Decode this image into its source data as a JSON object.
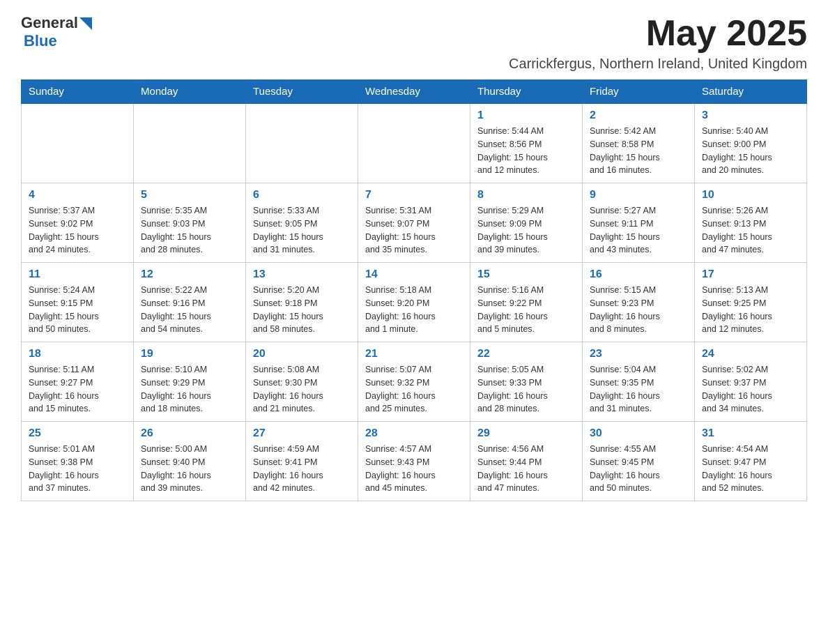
{
  "header": {
    "logo_general": "General",
    "logo_blue": "Blue",
    "month_title": "May 2025",
    "location": "Carrickfergus, Northern Ireland, United Kingdom"
  },
  "days_of_week": [
    "Sunday",
    "Monday",
    "Tuesday",
    "Wednesday",
    "Thursday",
    "Friday",
    "Saturday"
  ],
  "weeks": [
    [
      {
        "day": "",
        "info": ""
      },
      {
        "day": "",
        "info": ""
      },
      {
        "day": "",
        "info": ""
      },
      {
        "day": "",
        "info": ""
      },
      {
        "day": "1",
        "info": "Sunrise: 5:44 AM\nSunset: 8:56 PM\nDaylight: 15 hours\nand 12 minutes."
      },
      {
        "day": "2",
        "info": "Sunrise: 5:42 AM\nSunset: 8:58 PM\nDaylight: 15 hours\nand 16 minutes."
      },
      {
        "day": "3",
        "info": "Sunrise: 5:40 AM\nSunset: 9:00 PM\nDaylight: 15 hours\nand 20 minutes."
      }
    ],
    [
      {
        "day": "4",
        "info": "Sunrise: 5:37 AM\nSunset: 9:02 PM\nDaylight: 15 hours\nand 24 minutes."
      },
      {
        "day": "5",
        "info": "Sunrise: 5:35 AM\nSunset: 9:03 PM\nDaylight: 15 hours\nand 28 minutes."
      },
      {
        "day": "6",
        "info": "Sunrise: 5:33 AM\nSunset: 9:05 PM\nDaylight: 15 hours\nand 31 minutes."
      },
      {
        "day": "7",
        "info": "Sunrise: 5:31 AM\nSunset: 9:07 PM\nDaylight: 15 hours\nand 35 minutes."
      },
      {
        "day": "8",
        "info": "Sunrise: 5:29 AM\nSunset: 9:09 PM\nDaylight: 15 hours\nand 39 minutes."
      },
      {
        "day": "9",
        "info": "Sunrise: 5:27 AM\nSunset: 9:11 PM\nDaylight: 15 hours\nand 43 minutes."
      },
      {
        "day": "10",
        "info": "Sunrise: 5:26 AM\nSunset: 9:13 PM\nDaylight: 15 hours\nand 47 minutes."
      }
    ],
    [
      {
        "day": "11",
        "info": "Sunrise: 5:24 AM\nSunset: 9:15 PM\nDaylight: 15 hours\nand 50 minutes."
      },
      {
        "day": "12",
        "info": "Sunrise: 5:22 AM\nSunset: 9:16 PM\nDaylight: 15 hours\nand 54 minutes."
      },
      {
        "day": "13",
        "info": "Sunrise: 5:20 AM\nSunset: 9:18 PM\nDaylight: 15 hours\nand 58 minutes."
      },
      {
        "day": "14",
        "info": "Sunrise: 5:18 AM\nSunset: 9:20 PM\nDaylight: 16 hours\nand 1 minute."
      },
      {
        "day": "15",
        "info": "Sunrise: 5:16 AM\nSunset: 9:22 PM\nDaylight: 16 hours\nand 5 minutes."
      },
      {
        "day": "16",
        "info": "Sunrise: 5:15 AM\nSunset: 9:23 PM\nDaylight: 16 hours\nand 8 minutes."
      },
      {
        "day": "17",
        "info": "Sunrise: 5:13 AM\nSunset: 9:25 PM\nDaylight: 16 hours\nand 12 minutes."
      }
    ],
    [
      {
        "day": "18",
        "info": "Sunrise: 5:11 AM\nSunset: 9:27 PM\nDaylight: 16 hours\nand 15 minutes."
      },
      {
        "day": "19",
        "info": "Sunrise: 5:10 AM\nSunset: 9:29 PM\nDaylight: 16 hours\nand 18 minutes."
      },
      {
        "day": "20",
        "info": "Sunrise: 5:08 AM\nSunset: 9:30 PM\nDaylight: 16 hours\nand 21 minutes."
      },
      {
        "day": "21",
        "info": "Sunrise: 5:07 AM\nSunset: 9:32 PM\nDaylight: 16 hours\nand 25 minutes."
      },
      {
        "day": "22",
        "info": "Sunrise: 5:05 AM\nSunset: 9:33 PM\nDaylight: 16 hours\nand 28 minutes."
      },
      {
        "day": "23",
        "info": "Sunrise: 5:04 AM\nSunset: 9:35 PM\nDaylight: 16 hours\nand 31 minutes."
      },
      {
        "day": "24",
        "info": "Sunrise: 5:02 AM\nSunset: 9:37 PM\nDaylight: 16 hours\nand 34 minutes."
      }
    ],
    [
      {
        "day": "25",
        "info": "Sunrise: 5:01 AM\nSunset: 9:38 PM\nDaylight: 16 hours\nand 37 minutes."
      },
      {
        "day": "26",
        "info": "Sunrise: 5:00 AM\nSunset: 9:40 PM\nDaylight: 16 hours\nand 39 minutes."
      },
      {
        "day": "27",
        "info": "Sunrise: 4:59 AM\nSunset: 9:41 PM\nDaylight: 16 hours\nand 42 minutes."
      },
      {
        "day": "28",
        "info": "Sunrise: 4:57 AM\nSunset: 9:43 PM\nDaylight: 16 hours\nand 45 minutes."
      },
      {
        "day": "29",
        "info": "Sunrise: 4:56 AM\nSunset: 9:44 PM\nDaylight: 16 hours\nand 47 minutes."
      },
      {
        "day": "30",
        "info": "Sunrise: 4:55 AM\nSunset: 9:45 PM\nDaylight: 16 hours\nand 50 minutes."
      },
      {
        "day": "31",
        "info": "Sunrise: 4:54 AM\nSunset: 9:47 PM\nDaylight: 16 hours\nand 52 minutes."
      }
    ]
  ]
}
